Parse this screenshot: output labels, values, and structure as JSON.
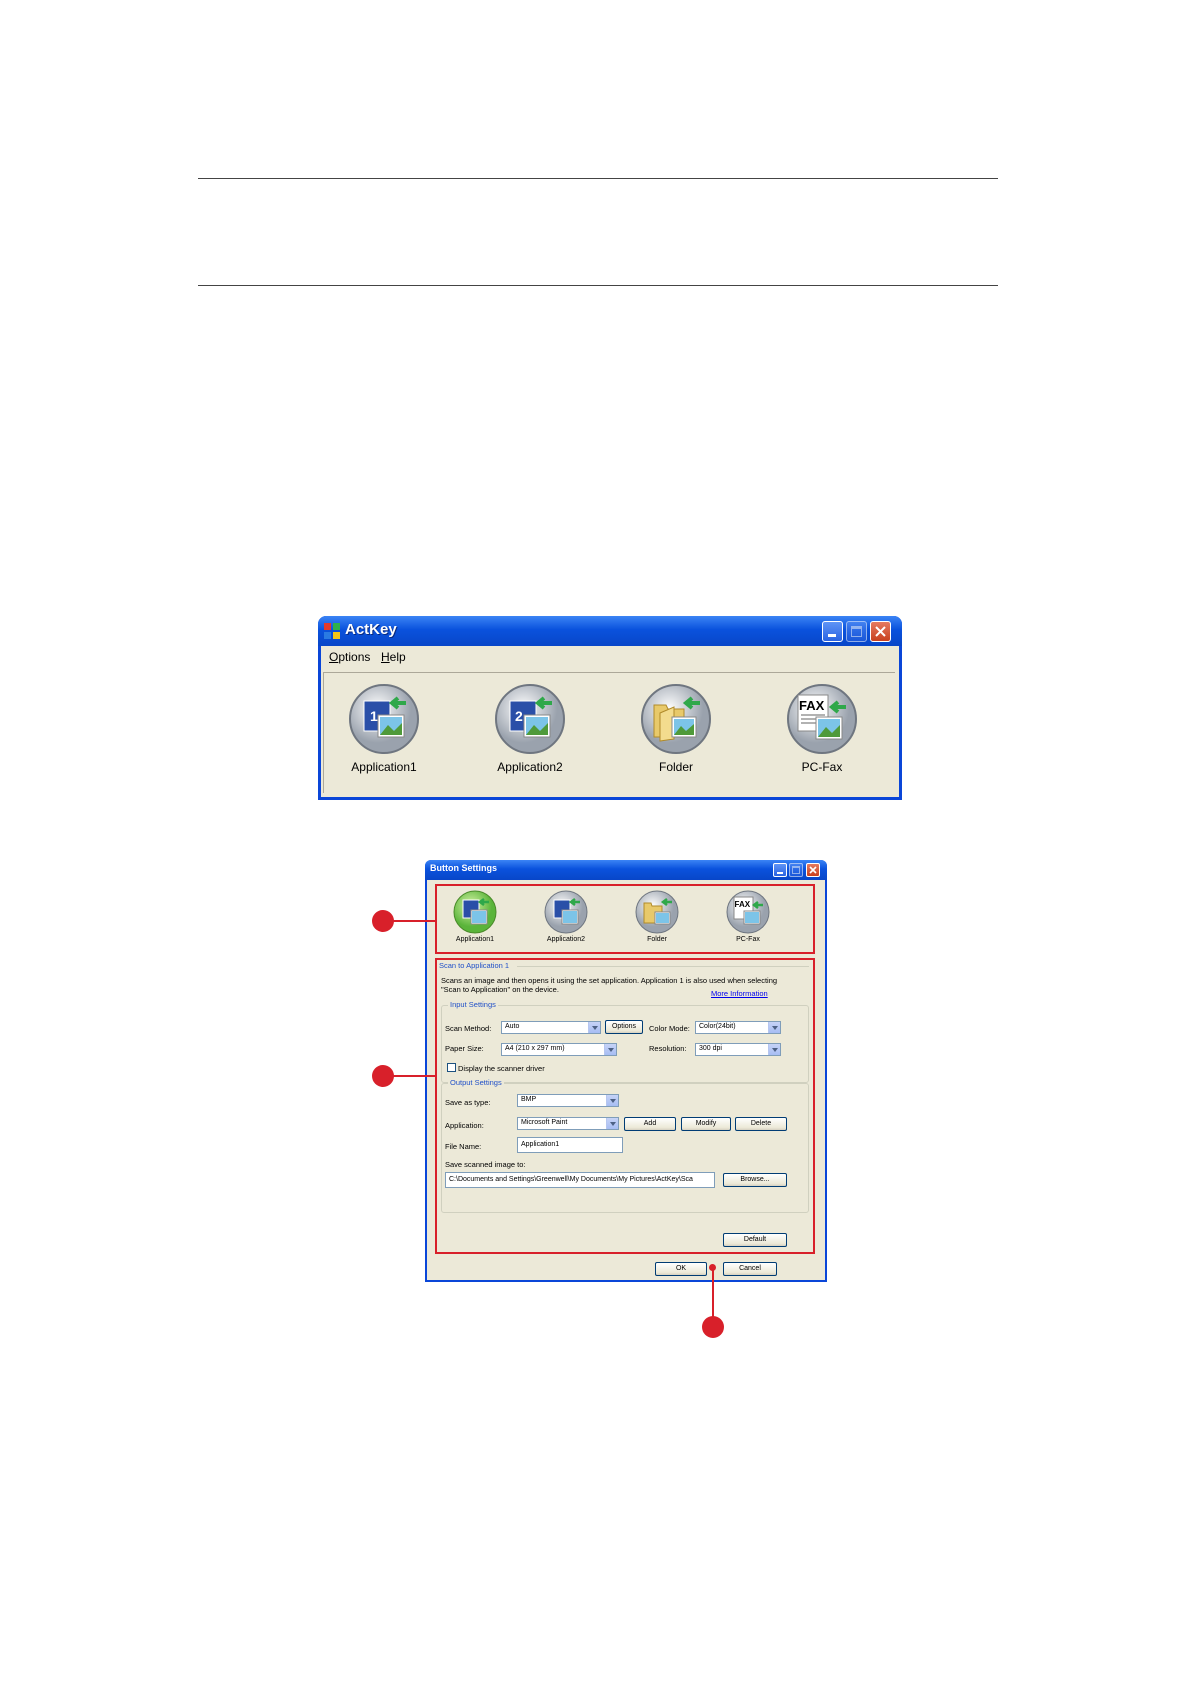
{
  "actkey": {
    "title": "ActKey",
    "menu": [
      {
        "accel": "O",
        "rest": "ptions"
      },
      {
        "accel": "H",
        "rest": "elp"
      }
    ],
    "buttons": [
      "Application1",
      "Application2",
      "Folder",
      "PC-Fax"
    ]
  },
  "button_settings": {
    "title": "Button Settings",
    "tabs": [
      "Application1",
      "Application2",
      "Folder",
      "PC-Fax"
    ],
    "section_title": "Scan to Application 1",
    "description_line1": "Scans an image and then opens it using the set application. Application 1 is also used when selecting",
    "description_line2": "\"Scan to Application\" on the device.",
    "more_info": "More Information",
    "input_settings": {
      "legend": "Input Settings",
      "scan_method_label": "Scan Method:",
      "scan_method_value": "Auto",
      "options_button": "Options",
      "color_mode_label": "Color Mode:",
      "color_mode_value": "Color(24bit)",
      "paper_size_label": "Paper Size:",
      "paper_size_value": "A4 (210 x 297 mm)",
      "resolution_label": "Resolution:",
      "resolution_value": "300 dpi",
      "display_driver_label": "Display the scanner driver"
    },
    "output_settings": {
      "legend": "Output Settings",
      "save_type_label": "Save as type:",
      "save_type_value": "BMP",
      "application_label": "Application:",
      "application_value": "Microsoft Paint",
      "add_button": "Add",
      "modify_button": "Modify",
      "delete_button": "Delete",
      "file_name_label": "File Name:",
      "file_name_value": "Application1",
      "save_to_label": "Save scanned image to:",
      "save_to_value": "C:\\Documents and Settings\\Greenwell\\My Documents\\My Pictures\\ActKey\\Sca",
      "browse_button": "Browse..."
    },
    "default_button": "Default",
    "ok_button": "OK",
    "cancel_button": "Cancel"
  },
  "colors": {
    "xp_title_blue": "#0a52dd",
    "dialog_face": "#ece9d8",
    "callout_red": "#d8202a"
  }
}
